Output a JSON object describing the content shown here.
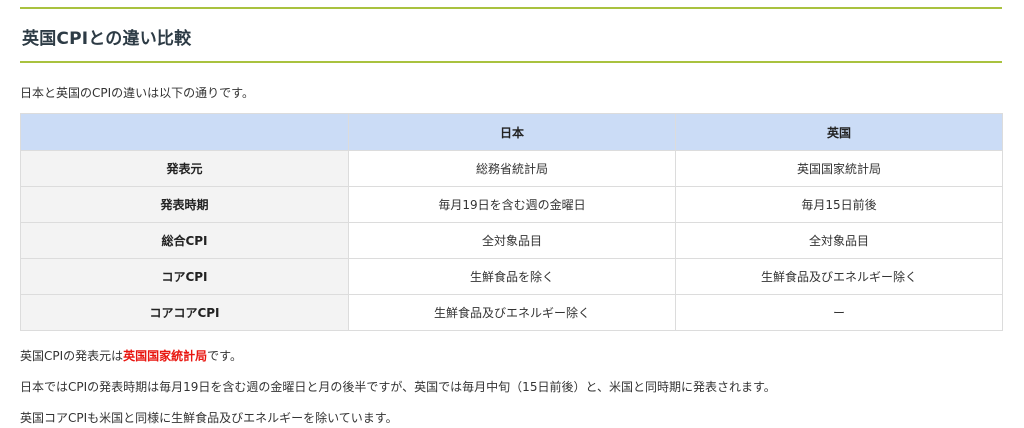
{
  "heading": "英国CPIとの違い比較",
  "intro": "日本と英国のCPIの違いは以下の通りです。",
  "table": {
    "headers": [
      "",
      "日本",
      "英国"
    ],
    "rows": [
      {
        "label": "発表元",
        "japan": "総務省統計局",
        "uk": "英国国家統計局"
      },
      {
        "label": "発表時期",
        "japan": "毎月19日を含む週の金曜日",
        "uk": "毎月15日前後"
      },
      {
        "label": "総合CPI",
        "japan": "全対象品目",
        "uk": "全対象品目"
      },
      {
        "label": "コアCPI",
        "japan": "生鮮食品を除く",
        "uk": "生鮮食品及びエネルギー除く"
      },
      {
        "label": "コアコアCPI",
        "japan": "生鮮食品及びエネルギー除く",
        "uk": "ー"
      }
    ]
  },
  "notes": {
    "p1_before": "英国CPIの発表元は",
    "p1_highlight": "英国国家統計局",
    "p1_after": "です。",
    "p2": "日本ではCPIの発表時期は毎月19日を含む週の金曜日と月の後半ですが、英国では毎月中旬（15日前後）と、米国と同時期に発表されます。",
    "p3": "英国コアCPIも米国と同様に生鮮食品及びエネルギーを除いています。"
  },
  "colors": {
    "accent_line": "#a9c23f",
    "header_bg": "#cbdcf6",
    "highlight": "#e8150f"
  }
}
